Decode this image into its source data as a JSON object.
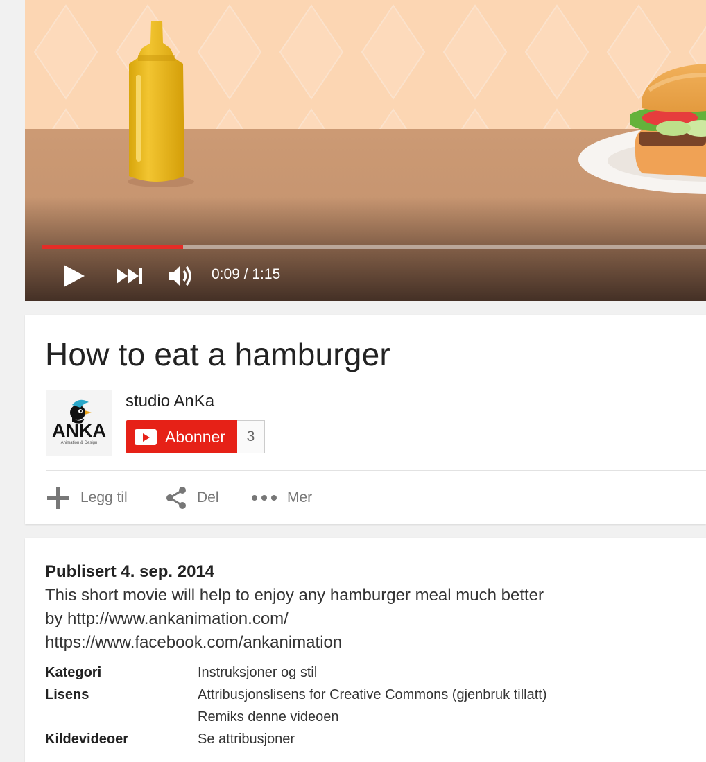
{
  "player": {
    "time_display": "0:09 / 1:15",
    "progress_fraction": 0.213,
    "accent_color": "#e52d27"
  },
  "video": {
    "title": "How to eat a hamburger"
  },
  "channel": {
    "name": "studio AnKa",
    "avatar_logo_text": "ANKA",
    "avatar_logo_subtext": "Animation & Design",
    "subscribe_label": "Abonner",
    "subscriber_count": "3",
    "subscribe_color": "#e62117"
  },
  "actions": {
    "add_label": "Legg til",
    "share_label": "Del",
    "more_label": "Mer"
  },
  "description": {
    "published": "Publisert 4. sep. 2014",
    "lines": [
      "This short movie will help to enjoy any hamburger meal much better",
      "by http://www.ankanimation.com/",
      "https://www.facebook.com/ankanimation"
    ],
    "meta": [
      {
        "label": "Kategori",
        "value": "Instruksjoner og stil"
      },
      {
        "label": "Lisens",
        "value": "Attribusjonslisens for Creative Commons (gjenbruk tillatt)"
      },
      {
        "label": "",
        "value": "Remiks denne videoen"
      },
      {
        "label": "Kildevideoer",
        "value": "Se attribusjoner"
      }
    ]
  }
}
